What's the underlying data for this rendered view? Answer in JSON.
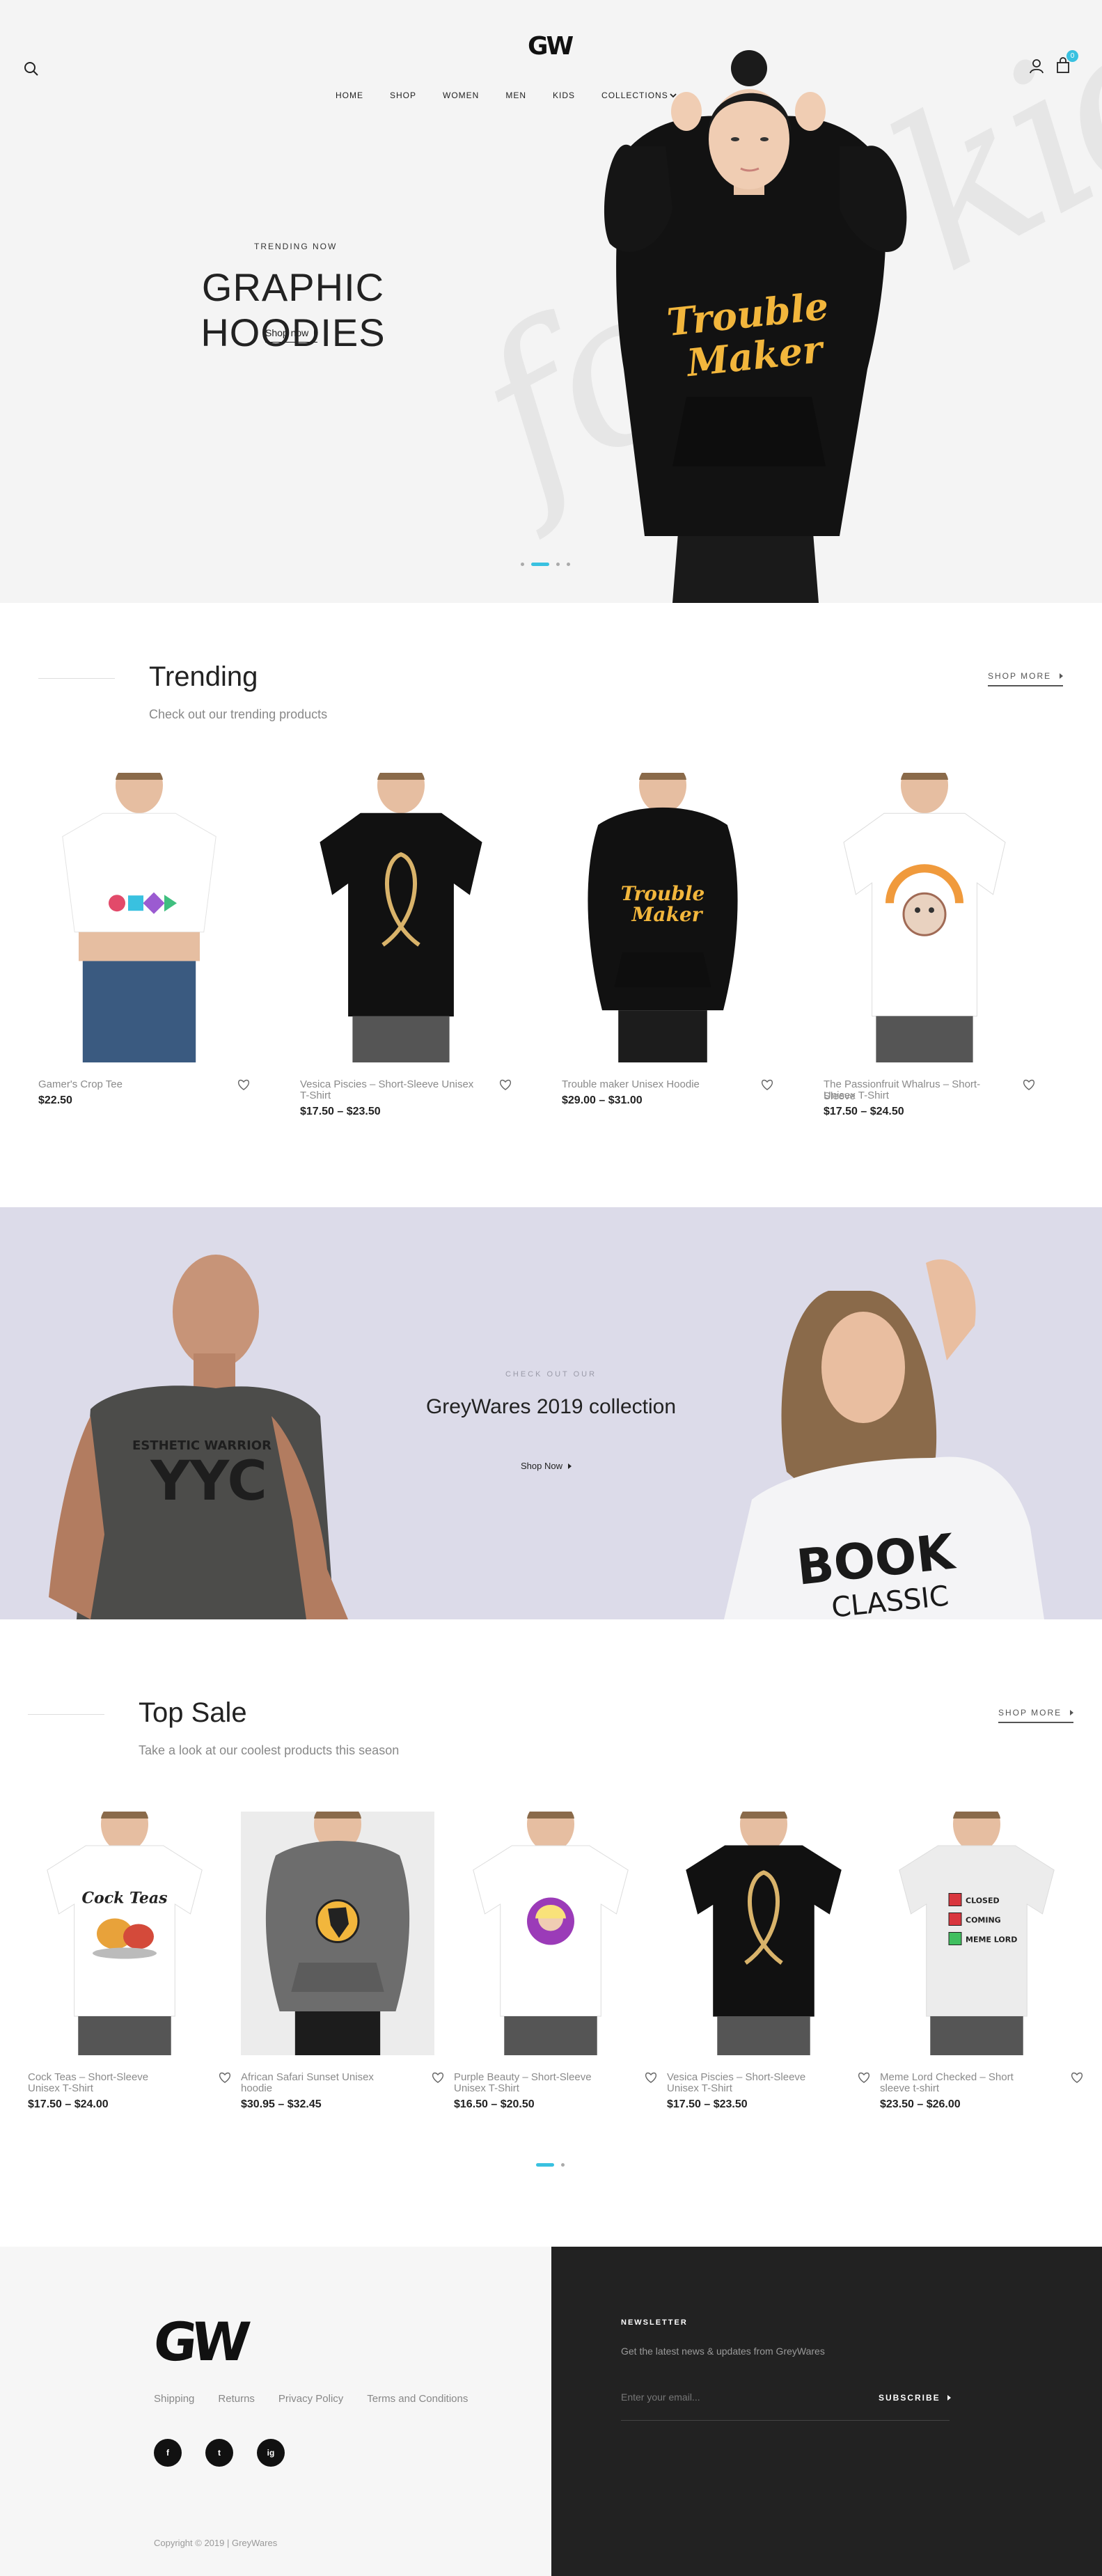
{
  "header": {
    "logo": "GW",
    "cart_count": "0",
    "nav": [
      "HOME",
      "SHOP",
      "WOMEN",
      "MEN",
      "KIDS",
      "COLLECTIONS"
    ]
  },
  "hero": {
    "eyebrow": "TRENDING NOW",
    "title": "GRAPHIC HOODIES",
    "button": "Shop now",
    "shirt_text_1": "Trouble",
    "shirt_text_2": "Maker",
    "script_watermark": "foxy kids"
  },
  "trending": {
    "title": "Trending",
    "subtitle": "Check out our trending products",
    "shop_more": "SHOP MORE",
    "products": [
      {
        "name_1": "Gamer's Crop Tee",
        "name_2": "",
        "price": "$22.50",
        "shirt": "#ffffff",
        "kind": "crop",
        "print": "gamer"
      },
      {
        "name_1": "Vesica Piscies – Short-Sleeve Unisex",
        "name_2": "T-Shirt",
        "price": "$17.50 – $23.50",
        "shirt": "#111111",
        "kind": "tee",
        "print": "fish"
      },
      {
        "name_1": "Trouble maker Unisex Hoodie",
        "name_2": "",
        "price": "$29.00 – $31.00",
        "shirt": "#111111",
        "kind": "hoodie",
        "print": "trouble"
      },
      {
        "name_1": "The Passionfruit Whalrus – Short-Sleeve",
        "name_2": "Unisex T-Shirt",
        "price": "$17.50 – $24.50",
        "shirt": "#ffffff",
        "kind": "tee",
        "print": "walrus"
      }
    ]
  },
  "banner": {
    "eyebrow": "CHECK OUT OUR",
    "title": "GreyWares 2019 collection",
    "button": "Shop Now",
    "left_shirt_text": "YYC",
    "left_shirt_small": "ESTHETIC WARRIOR",
    "right_shirt_text": "BOOK",
    "right_shirt_small": "CLASSIC"
  },
  "top_sale": {
    "title": "Top Sale",
    "subtitle": "Take a look at our coolest products this season",
    "shop_more": "SHOP MORE",
    "products": [
      {
        "name_1": "Cock Teas – Short-Sleeve",
        "name_2": "Unisex T-Shirt",
        "price": "$17.50 – $24.00",
        "shirt": "#ffffff",
        "kind": "tee",
        "print": "cock"
      },
      {
        "name_1": "African Safari Sunset Unisex",
        "name_2": "hoodie",
        "price": "$30.95 – $32.45",
        "shirt": "#6d6d6d",
        "kind": "hoodie",
        "print": "africa"
      },
      {
        "name_1": "Purple Beauty – Short-Sleeve",
        "name_2": "Unisex T-Shirt",
        "price": "$16.50 – $20.50",
        "shirt": "#ffffff",
        "kind": "tee",
        "print": "purple"
      },
      {
        "name_1": "Vesica Piscies – Short-Sleeve",
        "name_2": "Unisex T-Shirt",
        "price": "$17.50 – $23.50",
        "shirt": "#111111",
        "kind": "tee",
        "print": "fish"
      },
      {
        "name_1": "Meme Lord Checked – Short",
        "name_2": "sleeve t-shirt",
        "price": "$23.50 – $26.00",
        "shirt": "#ececec",
        "kind": "tee",
        "print": "meme"
      }
    ],
    "print_texts": {
      "cock": "Cock Teas",
      "meme_1": "CLOSED",
      "meme_2": "COMING",
      "meme_3": "MEME LORD"
    }
  },
  "footer": {
    "logo": "GW",
    "links": [
      "Shipping",
      "Returns",
      "Privacy Policy",
      "Terms and Conditions"
    ],
    "socials": [
      "f",
      "t",
      "ig"
    ],
    "copyright": "Copyright © 2019 | GreyWares",
    "newsletter_title": "NEWSLETTER",
    "newsletter_sub": "Get the latest news & updates from GreyWares",
    "email_placeholder": "Enter your email...",
    "subscribe": "SUBSCRIBE"
  },
  "colors": {
    "accent": "#39c1e0",
    "banner_bg": "#dcdbe9",
    "footer_dark": "#222222",
    "hoodie_print": "#f2b63c"
  }
}
